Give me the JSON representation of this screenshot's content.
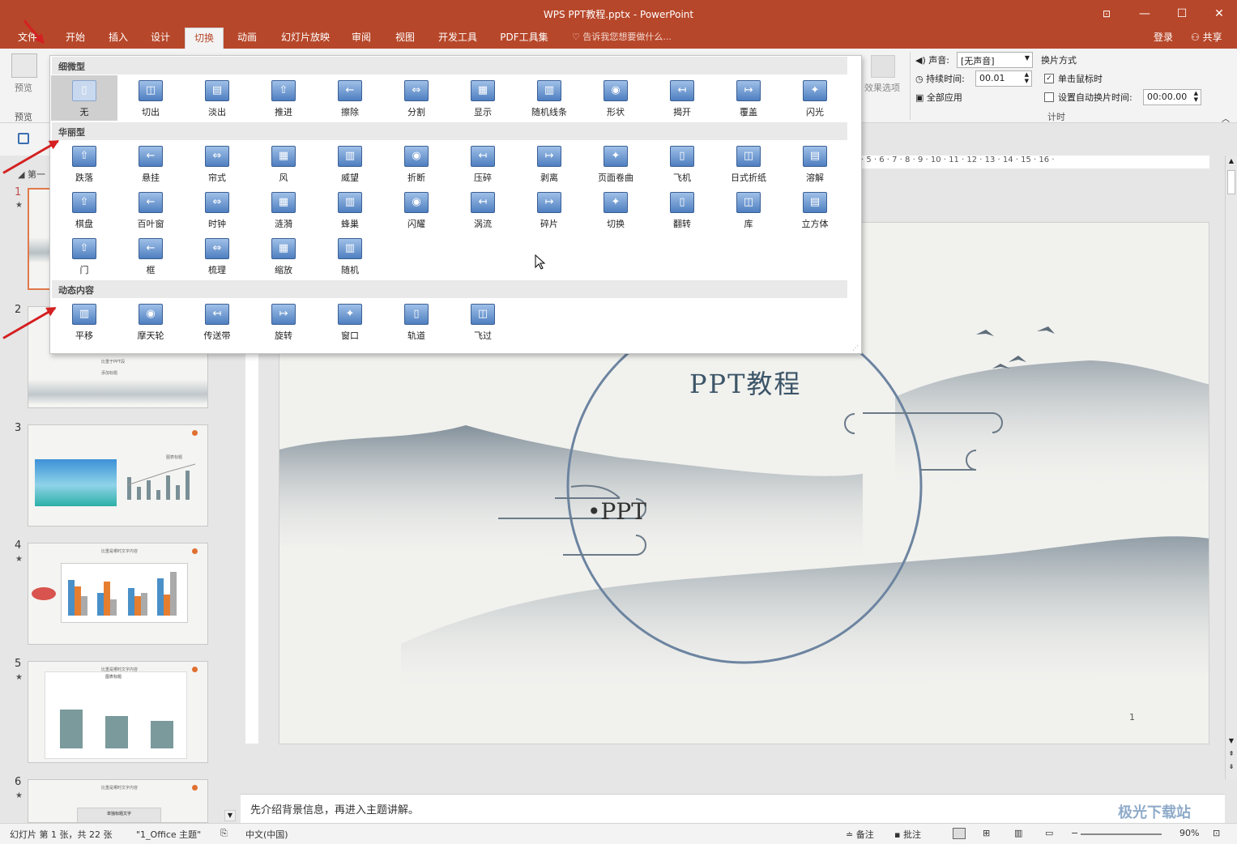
{
  "window": {
    "title": "WPS PPT教程.pptx - PowerPoint",
    "min": "—",
    "restore": "☐",
    "close": "✕",
    "ribbon_opts": "⊡"
  },
  "tabs": [
    "文件",
    "开始",
    "插入",
    "设计",
    "切换",
    "动画",
    "幻灯片放映",
    "审阅",
    "视图",
    "开发工具",
    "PDF工具集"
  ],
  "active_tab": "切换",
  "tellme": "告诉我您想要做什么...",
  "login": "登录",
  "share": "共享",
  "ribbon": {
    "preview_label": "预览",
    "preview_group": "预览",
    "effect_options": "效果选项",
    "sound_label": "声音:",
    "sound_value": "[无声音]",
    "duration_label": "持续时间:",
    "duration_value": "00.01",
    "apply_all": "全部应用",
    "advance_title": "换片方式",
    "on_click": "单击鼠标时",
    "on_click_checked": true,
    "auto_after": "设置自动换片时间:",
    "auto_after_value": "00:00.00",
    "auto_after_checked": false,
    "timing_group": "计时"
  },
  "gallery": {
    "subtle_title": "细微型",
    "subtle": [
      "无",
      "切出",
      "淡出",
      "推进",
      "擦除",
      "分割",
      "显示",
      "随机线条",
      "形状",
      "揭开",
      "覆盖",
      "闪光"
    ],
    "exciting_title": "华丽型",
    "exciting": [
      "跌落",
      "悬挂",
      "帘式",
      "风",
      "威望",
      "折断",
      "压碎",
      "剥离",
      "页面卷曲",
      "飞机",
      "日式折纸",
      "溶解",
      "棋盘",
      "百叶窗",
      "时钟",
      "涟漪",
      "蜂巢",
      "闪耀",
      "涡流",
      "碎片",
      "切换",
      "翻转",
      "库",
      "立方体",
      "门",
      "框",
      "梳理",
      "缩放",
      "随机"
    ],
    "dynamic_title": "动态内容",
    "dynamic": [
      "平移",
      "摩天轮",
      "传送带",
      "旋转",
      "窗口",
      "轨道",
      "飞过"
    ],
    "selected": "无"
  },
  "slides": {
    "section_label": "第一",
    "numbers": [
      "1",
      "2",
      "3",
      "4",
      "5",
      "6"
    ],
    "star": "★",
    "thumb4_title": "比重是哪时文字内容",
    "thumb5_title": "比重是哪时文字内容",
    "thumb5_subtitle": "图表标题",
    "thumb6_title": "比重是哪时文字内容",
    "thumb6_subtitle": "单独标题文字",
    "thumb3_title": "图表标题",
    "thumb2_title": "比重于PPT段",
    "thumb2_sub": "添加标题"
  },
  "ruler": {
    "h_ticks": [
      "5",
      "6",
      "7",
      "8",
      "9",
      "10",
      "11",
      "12",
      "13",
      "14",
      "15",
      "16"
    ]
  },
  "slide": {
    "title": "PPT教程",
    "bullet": "•PPT",
    "page": "1"
  },
  "notes": "先介绍背景信息，再进入主题讲解。",
  "status": {
    "slide_info": "幻灯片 第 1 张，共 22 张",
    "theme": "\"1_Office 主题\"",
    "language": "中文(中国)",
    "notes_btn": "备注",
    "comments_btn": "批注",
    "zoom": "90%",
    "watermark": "极光下载站"
  }
}
